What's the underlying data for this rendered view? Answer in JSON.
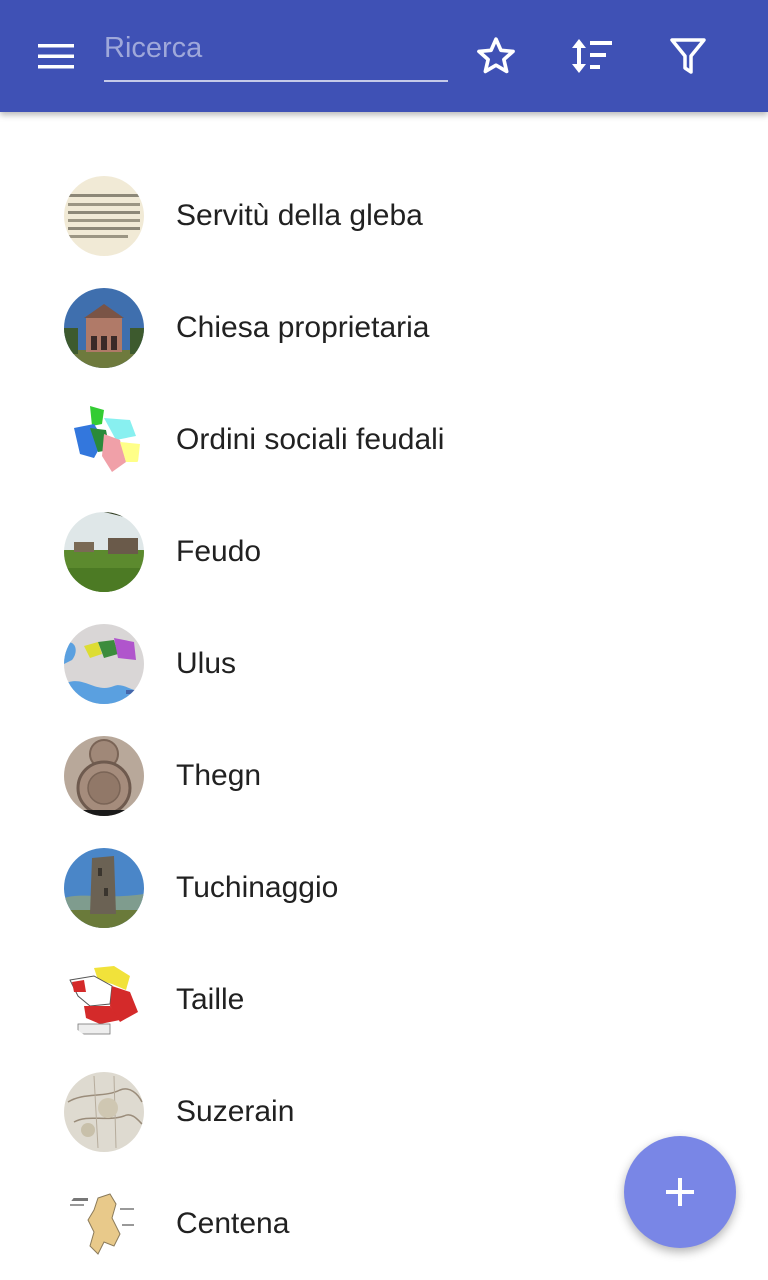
{
  "app_bar": {
    "search_placeholder": "Ricerca",
    "icons": [
      "menu-icon",
      "star-icon",
      "sort-icon",
      "filter-icon"
    ],
    "color": "#3f51b5"
  },
  "items": [
    {
      "label": "Servitù della gleba",
      "thumbnail": "manuscript-thumbnail"
    },
    {
      "label": "Chiesa proprietaria",
      "thumbnail": "church-thumbnail"
    },
    {
      "label": "Ordini sociali feudali",
      "thumbnail": "colored-map-thumbnail"
    },
    {
      "label": "Feudo",
      "thumbnail": "field-thumbnail"
    },
    {
      "label": "Ulus",
      "thumbnail": "world-map-thumbnail"
    },
    {
      "label": "Thegn",
      "thumbnail": "medallion-thumbnail"
    },
    {
      "label": "Tuchinaggio",
      "thumbnail": "tower-thumbnail"
    },
    {
      "label": "Taille",
      "thumbnail": "france-map-thumbnail"
    },
    {
      "label": "Suzerain",
      "thumbnail": "old-map-thumbnail"
    },
    {
      "label": "Centena",
      "thumbnail": "island-map-thumbnail"
    }
  ],
  "fab": {
    "icon": "plus-icon",
    "color": "#7986e6"
  }
}
